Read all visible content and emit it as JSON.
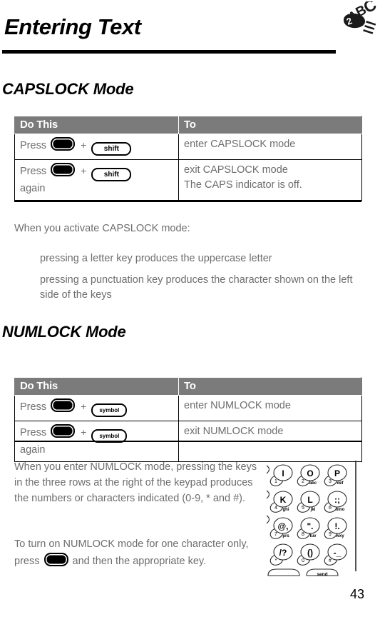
{
  "header": {
    "title": "Entering Text",
    "icon_name": "2abc-chapter-icon",
    "icon_text": "2ABC"
  },
  "sections": [
    {
      "heading": "CAPSLOCK Mode",
      "table": {
        "columns": [
          "Do This",
          "To"
        ],
        "rows": [
          {
            "do_prefix": "Press",
            "key1": "menu-key",
            "plus": "+",
            "key2": "shift",
            "do_suffix": "",
            "to_line1": "enter CAPSLOCK mode",
            "to_line2": ""
          },
          {
            "do_prefix": "Press",
            "key1": "menu-key",
            "plus": "+",
            "key2": "shift",
            "do_suffix": "again",
            "to_line1": "exit CAPSLOCK mode",
            "to_line2": "The CAPS indicator is off."
          }
        ]
      },
      "intro": "When you activate CAPSLOCK mode:",
      "bullets": [
        "pressing a letter key produces the uppercase letter",
        "pressing a punctuation key produces the character shown on the left side of the keys"
      ]
    },
    {
      "heading": "NUMLOCK Mode",
      "table": {
        "columns": [
          "Do This",
          "To"
        ],
        "rows": [
          {
            "do_prefix": "Press",
            "key1": "menu-key",
            "plus": "+",
            "key2": "symbol",
            "do_suffix": "",
            "to_line1": "enter NUMLOCK mode",
            "to_line2": ""
          },
          {
            "do_prefix": "Press",
            "key1": "menu-key",
            "plus": "+",
            "key2": "symbol",
            "do_suffix": "again",
            "to_line1": "exit NUMLOCK mode",
            "to_line2": ""
          }
        ]
      },
      "para1": "When you enter NUMLOCK mode, pressing the keys in the three rows at the right of the keypad produces the numbers or characters indicated (0-9, * and #).",
      "para2_before": "To turn on NUMLOCK mode for one character only, press",
      "para2_after": "and then the appropriate key."
    }
  ],
  "keypad": {
    "name": "phone-keypad-illustration",
    "keys": [
      {
        "letter": "I",
        "num": "1",
        "sub": ""
      },
      {
        "letter": "O",
        "num": "2",
        "sub": "abc"
      },
      {
        "letter": "P",
        "num": "3",
        "sub": "def"
      },
      {
        "letter": "K",
        "num": "4",
        "sub": "ghi"
      },
      {
        "letter": "L",
        "num": "5",
        "sub": "jkl"
      },
      {
        "letter": ":;",
        "num": "6",
        "sub": "mno"
      },
      {
        "letter": "@,",
        "num": "7",
        "sub": "prs"
      },
      {
        "letter": "\".",
        "num": "8",
        "sub": "tuv"
      },
      {
        "letter": "!.",
        "num": "9",
        "sub": "wxy"
      },
      {
        "letter": "/?",
        "num": "*",
        "sub": ""
      },
      {
        "letter": "()",
        "num": "0",
        "sub": ""
      },
      {
        "letter": "-_",
        "num": "#",
        "sub": ""
      }
    ],
    "bottom_keys": [
      "",
      "send"
    ]
  },
  "footer": {
    "page_number": "43"
  }
}
